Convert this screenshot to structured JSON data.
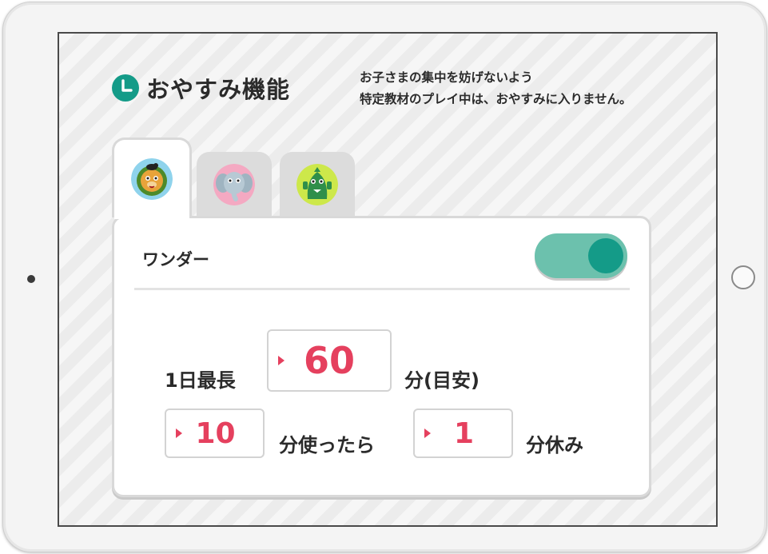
{
  "page": {
    "title": "おやすみ機能",
    "note_line1": "お子さまの集中を妨げないよう",
    "note_line2": "特定教材のプレイ中は、おやすみに入りません。"
  },
  "tabs": [
    {
      "icon": "lion-avatar-icon",
      "active": true
    },
    {
      "icon": "elephant-avatar-icon",
      "active": false
    },
    {
      "icon": "green-monster-avatar-icon",
      "active": false
    }
  ],
  "card": {
    "character_name": "ワンダー",
    "toggle_on": true,
    "daily_max_label": "1日最長",
    "daily_max_value": "60",
    "daily_max_unit": "分(目安)",
    "use_value": "10",
    "use_unit": "分使ったら",
    "rest_value": "1",
    "rest_unit": "分休み"
  },
  "colors": {
    "accent_teal": "#149b88",
    "toggle_track": "#6cc1ad",
    "number_red": "#e5405e"
  }
}
